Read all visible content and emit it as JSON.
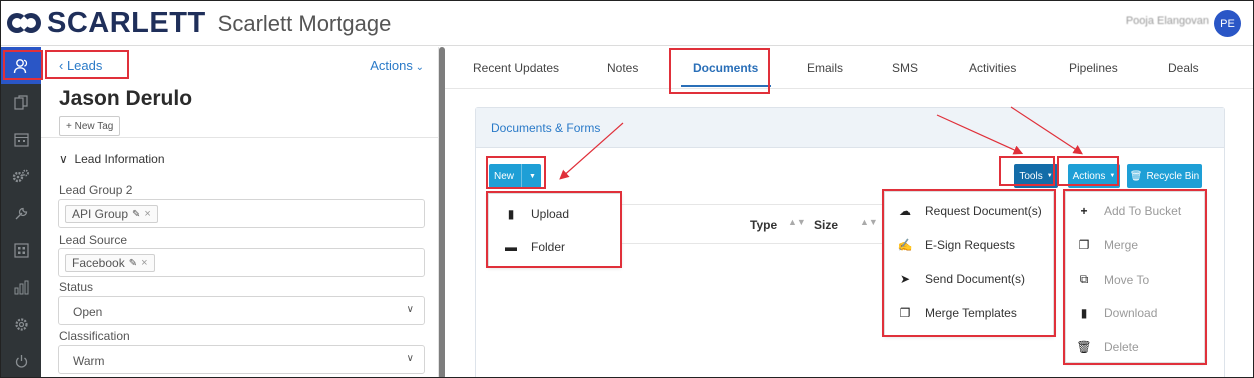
{
  "header": {
    "brand": "SCARLETT",
    "app_name": "Scarlett Mortgage",
    "user_name": "Pooja Elangovan",
    "avatar_initials": "PE"
  },
  "lead": {
    "back_label": "Leads",
    "actions_label": "Actions",
    "name": "Jason Derulo",
    "new_tag_label": "+ New Tag",
    "section_title": "Lead Information",
    "lead_group_label": "Lead Group 2",
    "lead_group_value": "API Group",
    "lead_source_label": "Lead Source",
    "lead_source_value": "Facebook",
    "status_label": "Status",
    "status_value": "Open",
    "classification_label": "Classification",
    "classification_value": "Warm"
  },
  "tabs": [
    {
      "label": "Recent Updates"
    },
    {
      "label": "Notes"
    },
    {
      "label": "Documents"
    },
    {
      "label": "Emails"
    },
    {
      "label": "SMS"
    },
    {
      "label": "Activities"
    },
    {
      "label": "Pipelines"
    },
    {
      "label": "Deals"
    }
  ],
  "documents": {
    "title": "Documents & Forms",
    "new_label": "New",
    "tools_label": "Tools",
    "actions_label": "Actions",
    "recycle_label": "Recycle Bin",
    "columns": [
      "Type",
      "Size"
    ]
  },
  "new_menu": [
    {
      "label": "Upload",
      "icon": "file-upload-icon"
    },
    {
      "label": "Folder",
      "icon": "folder-icon"
    }
  ],
  "tools_menu": [
    {
      "label": "Request Document(s)",
      "icon": "cloud-upload-icon"
    },
    {
      "label": "E-Sign Requests",
      "icon": "signature-icon"
    },
    {
      "label": "Send Document(s)",
      "icon": "paper-plane-icon"
    },
    {
      "label": "Merge Templates",
      "icon": "copy-icon"
    }
  ],
  "actions_menu": [
    {
      "label": "Add To Bucket",
      "icon": "plus-icon"
    },
    {
      "label": "Merge",
      "icon": "copy-icon"
    },
    {
      "label": "Move To",
      "icon": "move-icon"
    },
    {
      "label": "Download",
      "icon": "download-icon"
    },
    {
      "label": "Delete",
      "icon": "trash-icon"
    }
  ],
  "colors": {
    "brand": "#1f2f5a",
    "primary": "#1e9fd6",
    "tools_button": "#136ca8",
    "active_rail": "#2a56c6",
    "highlight": "#e0303a"
  }
}
